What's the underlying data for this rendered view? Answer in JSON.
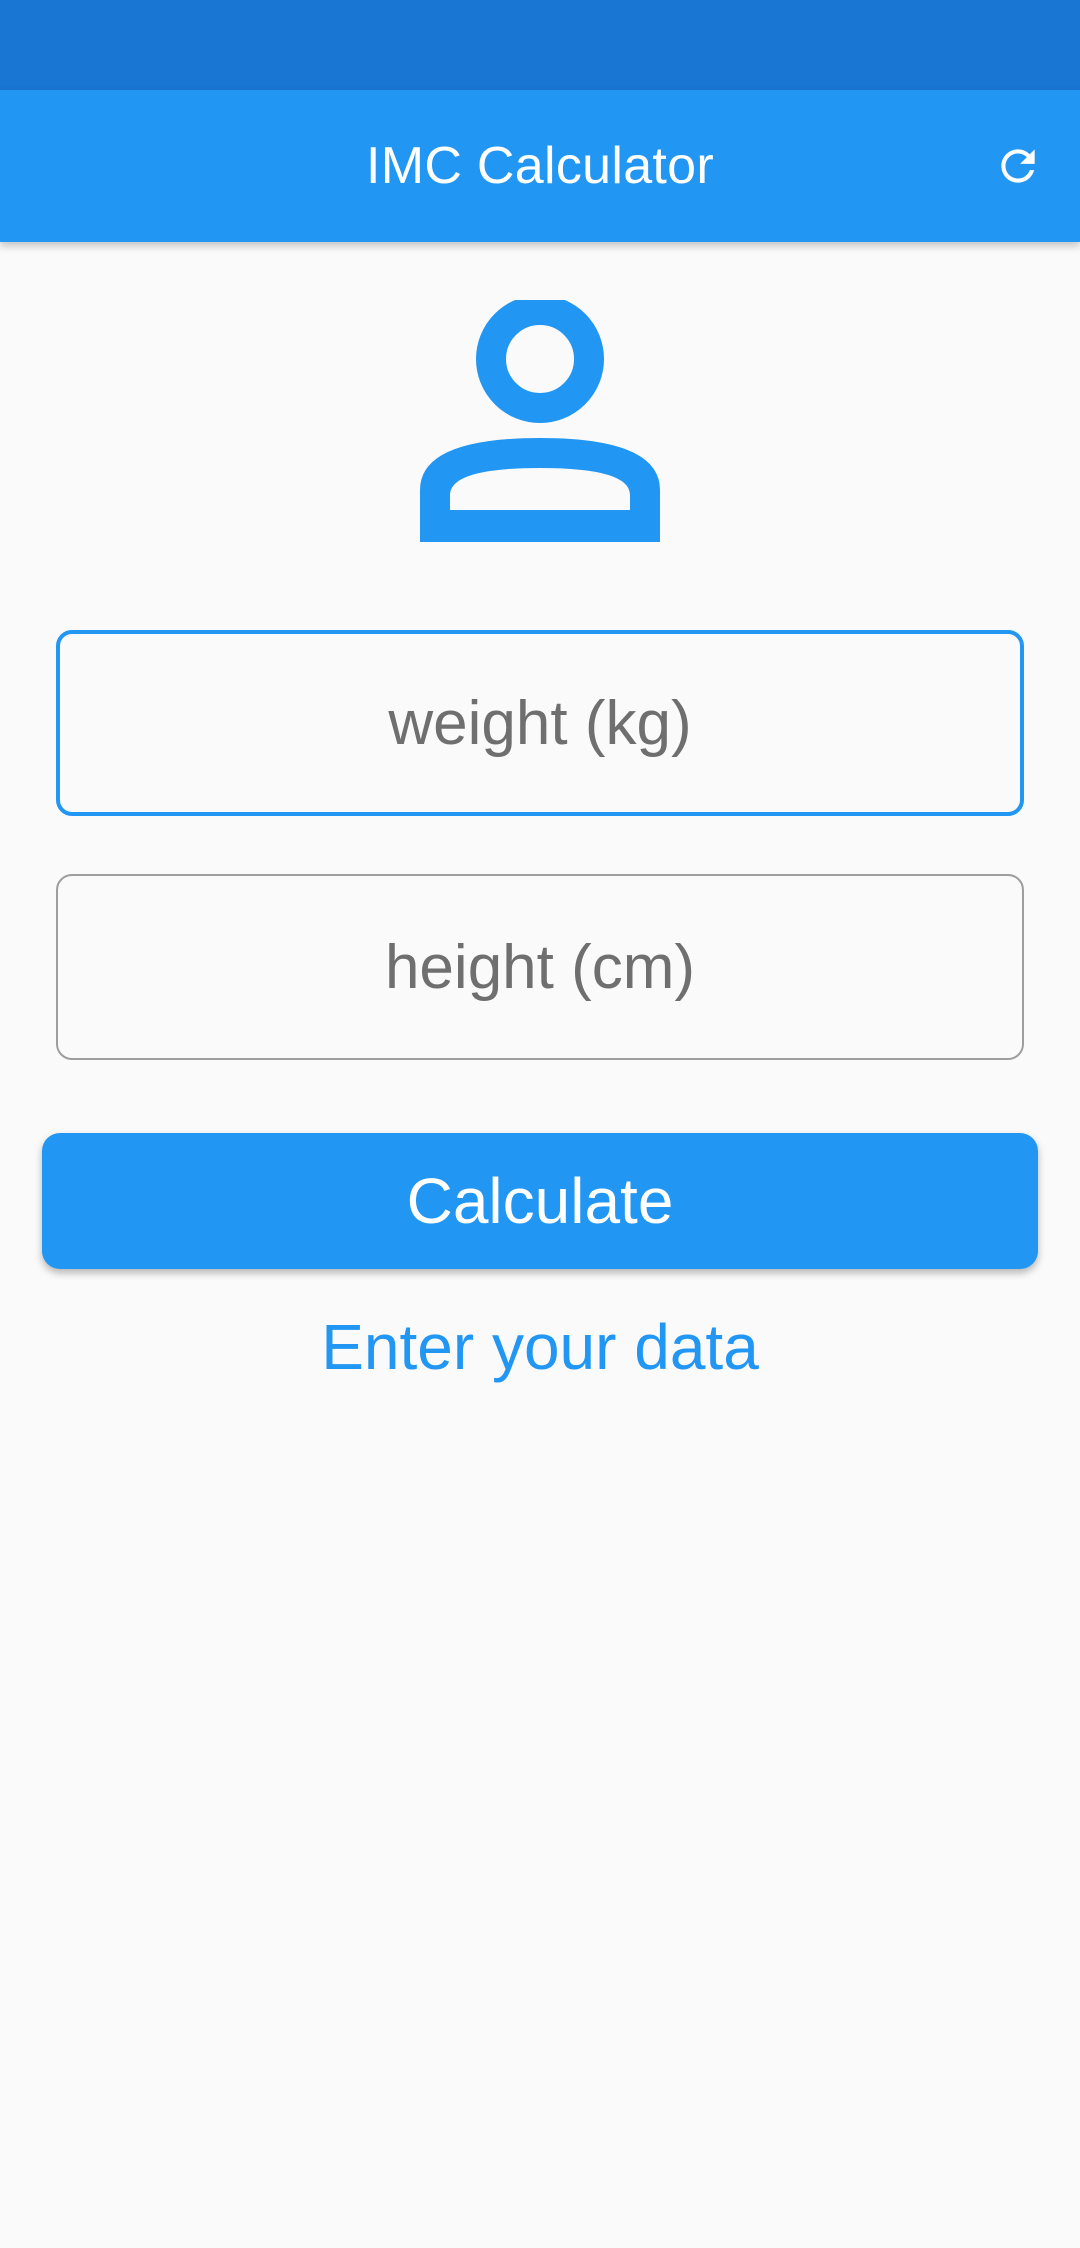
{
  "app_bar": {
    "title": "IMC Calculator",
    "refresh_icon": "refresh-icon"
  },
  "avatar": {
    "icon": "person-outline-icon"
  },
  "form": {
    "weight_placeholder": "weight (kg)",
    "weight_value": "",
    "height_placeholder": "height (cm)",
    "height_value": ""
  },
  "calculate_label": "Calculate",
  "info_text": "Enter your data",
  "colors": {
    "primary": "#2196f3",
    "status_bar": "#1976d2",
    "background": "#fafafa",
    "field_border_inactive": "#9e9e9e",
    "placeholder": "#6f6f6f"
  }
}
